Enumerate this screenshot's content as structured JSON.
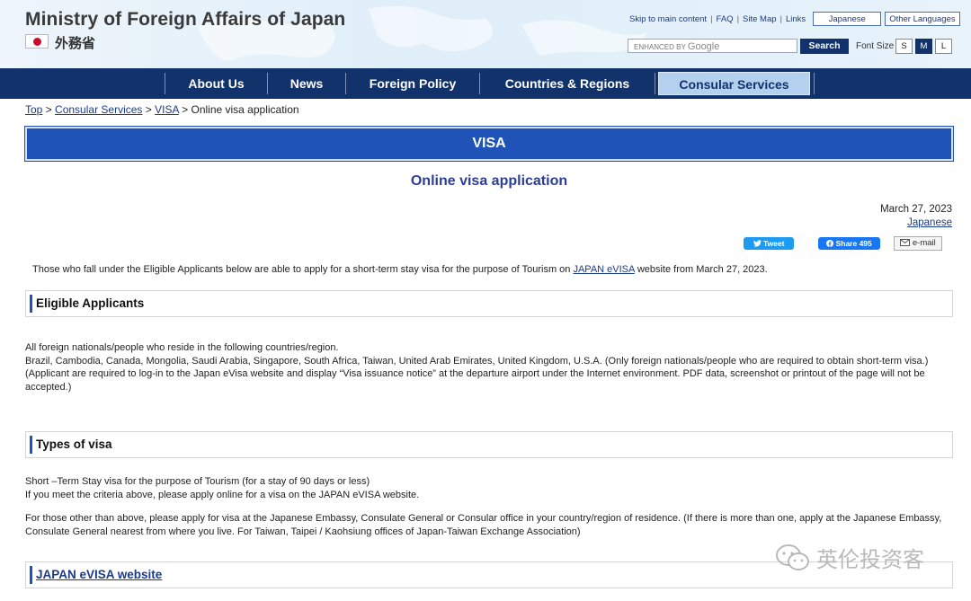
{
  "header": {
    "site_title": "Ministry of Foreign Affairs of Japan",
    "jp_name": "外務省",
    "top_links": [
      "Skip to main content",
      "FAQ",
      "Site Map",
      "Links"
    ],
    "japanese_btn": "Japanese",
    "other_languages_btn": "Other Languages",
    "search_prefix": "ENHANCED BY",
    "search_brand": "Google",
    "search_btn": "Search",
    "font_size_label": "Font Size",
    "font_sizes": [
      "S",
      "M",
      "L"
    ],
    "font_size_selected": "M"
  },
  "nav": {
    "items": [
      "About Us",
      "News",
      "Foreign Policy",
      "Countries & Regions",
      "Consular Services"
    ],
    "active": "Consular Services"
  },
  "breadcrumb": {
    "items": [
      "Top",
      "Consular Services",
      "VISA"
    ],
    "current": "Online visa application"
  },
  "banner": "VISA",
  "page": {
    "title": "Online visa application",
    "date": "March 27, 2023",
    "japanese_link": "Japanese",
    "tweet": "Tweet",
    "share": "Share 495",
    "email": "e-mail",
    "intro_before": "Those who fall under the Eligible Applicants below are able to apply for a short-term stay visa for the purpose of Tourism on",
    "intro_link": "JAPAN eVISA",
    "intro_after": "website from March 27, 2023."
  },
  "sections": {
    "eligible": {
      "heading": "Eligible Applicants",
      "lines": [
        "All foreign nationals/people who reside in the following countries/region.",
        "Brazil, Cambodia, Canada, Mongolia, Saudi Arabia, Singapore, South Africa, Taiwan, United Arab Emirates, United Kingdom, U.S.A. (Only foreign nationals/people who are required to obtain short-term visa.)",
        "(Applicant are required to log-in to the Japan eVisa website and display “Visa issuance notice” at the departure airport under the Internet environment. PDF data, screenshot or printout of the page will not be accepted.)"
      ]
    },
    "types": {
      "heading": "Types of visa",
      "lines": [
        "Short –Term Stay visa for the purpose of Tourism (for a stay of 90 days or less)",
        "If you meet the criteria above, please apply online for a visa on the JAPAN eVISA website."
      ],
      "para2": "For those other than above, please apply for visa at the Japanese Embassy, Consulate General or Consular office in your country/region of residence. (If there is more than one, apply at the Japanese Embassy, Consulate General nearest from where you live. For Taiwan, Taipei / Kaohsiung offices of Japan-Taiwan Exchange Association)"
    },
    "evisa": {
      "heading": "JAPAN eVISA website"
    }
  },
  "watermark": "英伦投资客",
  "colors": {
    "nav_bg": "#12326b",
    "banner_bg": "#1f53b8",
    "title_color": "#2c3e96",
    "link_color": "#1a3a8a",
    "active_nav_bg": "#b3d1ee"
  },
  "icons": [
    "flag-japan-icon",
    "twitter-bird-icon",
    "facebook-icon",
    "email-icon",
    "wechat-icon"
  ]
}
